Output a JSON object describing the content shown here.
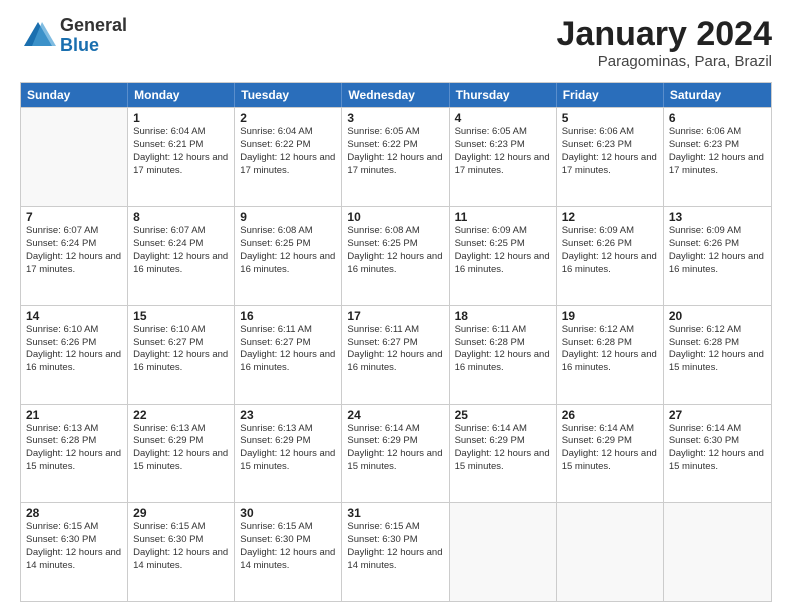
{
  "logo": {
    "general": "General",
    "blue": "Blue"
  },
  "title": "January 2024",
  "subtitle": "Paragominas, Para, Brazil",
  "headers": [
    "Sunday",
    "Monday",
    "Tuesday",
    "Wednesday",
    "Thursday",
    "Friday",
    "Saturday"
  ],
  "weeks": [
    [
      {
        "day": "",
        "sunrise": "",
        "sunset": "",
        "daylight": "",
        "empty": true
      },
      {
        "day": "1",
        "sunrise": "6:04 AM",
        "sunset": "6:21 PM",
        "daylight": "12 hours and 17 minutes."
      },
      {
        "day": "2",
        "sunrise": "6:04 AM",
        "sunset": "6:22 PM",
        "daylight": "12 hours and 17 minutes."
      },
      {
        "day": "3",
        "sunrise": "6:05 AM",
        "sunset": "6:22 PM",
        "daylight": "12 hours and 17 minutes."
      },
      {
        "day": "4",
        "sunrise": "6:05 AM",
        "sunset": "6:23 PM",
        "daylight": "12 hours and 17 minutes."
      },
      {
        "day": "5",
        "sunrise": "6:06 AM",
        "sunset": "6:23 PM",
        "daylight": "12 hours and 17 minutes."
      },
      {
        "day": "6",
        "sunrise": "6:06 AM",
        "sunset": "6:23 PM",
        "daylight": "12 hours and 17 minutes."
      }
    ],
    [
      {
        "day": "7",
        "sunrise": "6:07 AM",
        "sunset": "6:24 PM",
        "daylight": "12 hours and 17 minutes."
      },
      {
        "day": "8",
        "sunrise": "6:07 AM",
        "sunset": "6:24 PM",
        "daylight": "12 hours and 16 minutes."
      },
      {
        "day": "9",
        "sunrise": "6:08 AM",
        "sunset": "6:25 PM",
        "daylight": "12 hours and 16 minutes."
      },
      {
        "day": "10",
        "sunrise": "6:08 AM",
        "sunset": "6:25 PM",
        "daylight": "12 hours and 16 minutes."
      },
      {
        "day": "11",
        "sunrise": "6:09 AM",
        "sunset": "6:25 PM",
        "daylight": "12 hours and 16 minutes."
      },
      {
        "day": "12",
        "sunrise": "6:09 AM",
        "sunset": "6:26 PM",
        "daylight": "12 hours and 16 minutes."
      },
      {
        "day": "13",
        "sunrise": "6:09 AM",
        "sunset": "6:26 PM",
        "daylight": "12 hours and 16 minutes."
      }
    ],
    [
      {
        "day": "14",
        "sunrise": "6:10 AM",
        "sunset": "6:26 PM",
        "daylight": "12 hours and 16 minutes."
      },
      {
        "day": "15",
        "sunrise": "6:10 AM",
        "sunset": "6:27 PM",
        "daylight": "12 hours and 16 minutes."
      },
      {
        "day": "16",
        "sunrise": "6:11 AM",
        "sunset": "6:27 PM",
        "daylight": "12 hours and 16 minutes."
      },
      {
        "day": "17",
        "sunrise": "6:11 AM",
        "sunset": "6:27 PM",
        "daylight": "12 hours and 16 minutes."
      },
      {
        "day": "18",
        "sunrise": "6:11 AM",
        "sunset": "6:28 PM",
        "daylight": "12 hours and 16 minutes."
      },
      {
        "day": "19",
        "sunrise": "6:12 AM",
        "sunset": "6:28 PM",
        "daylight": "12 hours and 16 minutes."
      },
      {
        "day": "20",
        "sunrise": "6:12 AM",
        "sunset": "6:28 PM",
        "daylight": "12 hours and 15 minutes."
      }
    ],
    [
      {
        "day": "21",
        "sunrise": "6:13 AM",
        "sunset": "6:28 PM",
        "daylight": "12 hours and 15 minutes."
      },
      {
        "day": "22",
        "sunrise": "6:13 AM",
        "sunset": "6:29 PM",
        "daylight": "12 hours and 15 minutes."
      },
      {
        "day": "23",
        "sunrise": "6:13 AM",
        "sunset": "6:29 PM",
        "daylight": "12 hours and 15 minutes."
      },
      {
        "day": "24",
        "sunrise": "6:14 AM",
        "sunset": "6:29 PM",
        "daylight": "12 hours and 15 minutes."
      },
      {
        "day": "25",
        "sunrise": "6:14 AM",
        "sunset": "6:29 PM",
        "daylight": "12 hours and 15 minutes."
      },
      {
        "day": "26",
        "sunrise": "6:14 AM",
        "sunset": "6:29 PM",
        "daylight": "12 hours and 15 minutes."
      },
      {
        "day": "27",
        "sunrise": "6:14 AM",
        "sunset": "6:30 PM",
        "daylight": "12 hours and 15 minutes."
      }
    ],
    [
      {
        "day": "28",
        "sunrise": "6:15 AM",
        "sunset": "6:30 PM",
        "daylight": "12 hours and 14 minutes."
      },
      {
        "day": "29",
        "sunrise": "6:15 AM",
        "sunset": "6:30 PM",
        "daylight": "12 hours and 14 minutes."
      },
      {
        "day": "30",
        "sunrise": "6:15 AM",
        "sunset": "6:30 PM",
        "daylight": "12 hours and 14 minutes."
      },
      {
        "day": "31",
        "sunrise": "6:15 AM",
        "sunset": "6:30 PM",
        "daylight": "12 hours and 14 minutes."
      },
      {
        "day": "",
        "sunrise": "",
        "sunset": "",
        "daylight": "",
        "empty": true
      },
      {
        "day": "",
        "sunrise": "",
        "sunset": "",
        "daylight": "",
        "empty": true
      },
      {
        "day": "",
        "sunrise": "",
        "sunset": "",
        "daylight": "",
        "empty": true
      }
    ]
  ]
}
